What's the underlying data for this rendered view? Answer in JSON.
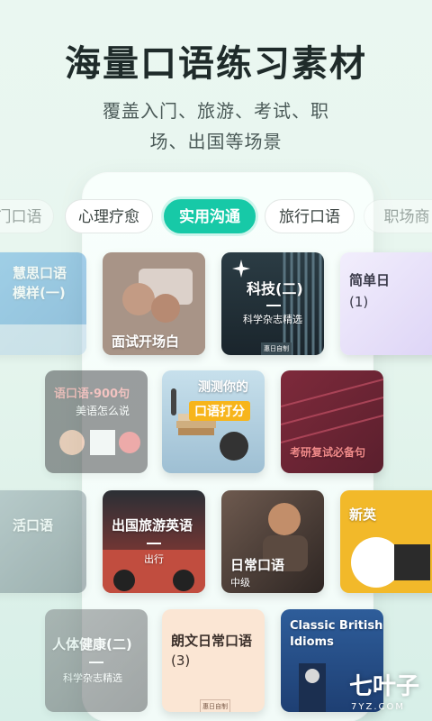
{
  "header": {
    "title": "海量口语练习素材",
    "subtitle_lines": [
      "覆盖入门、旅游、考试、职",
      "场、出国等场景"
    ]
  },
  "tabs": [
    {
      "label": "门口语",
      "active": false
    },
    {
      "label": "心理疗愈",
      "active": false
    },
    {
      "label": "实用沟通",
      "active": true
    },
    {
      "label": "旅行口语",
      "active": false
    },
    {
      "label": "职场商",
      "active": false
    }
  ],
  "cards": {
    "r1c0": {
      "line1": "慧思口语",
      "line2": "模样(一)"
    },
    "r1c1": {
      "title": "面试开场白"
    },
    "r1c2": {
      "title": "科技(二)",
      "sub": "科学杂志精选",
      "badge": "惠日自制"
    },
    "r1c3": {
      "title": "简单日",
      "sub": "(1)"
    },
    "r2c0": {
      "title": "语口语·900句",
      "sub": "美语怎么说"
    },
    "r2c1": {
      "line1": "测测你的",
      "line2": "口语打分"
    },
    "r2c2": {
      "title": "考研复试必备句"
    },
    "r3c0": {
      "title": "活口语"
    },
    "r3c1": {
      "title": "出国旅游英语",
      "sub": "出行"
    },
    "r3c2": {
      "title": "日常口语",
      "sub": "中级"
    },
    "r3c3": {
      "title": "新英"
    },
    "r4c0": {
      "title": "人体健康(二)",
      "sub": "科学杂志精选"
    },
    "r4c1": {
      "title": "朗文日常口语",
      "sub": "(3)",
      "badge": "惠日自制"
    },
    "r4c2": {
      "line1": "Classic British",
      "line2": "Idioms"
    }
  },
  "watermark": {
    "text": "七叶子",
    "domain": "7YZ.COM"
  },
  "colors": {
    "accent": "#17c9a7",
    "title": "#1f2b2a",
    "subtitle": "#4b5a58"
  }
}
